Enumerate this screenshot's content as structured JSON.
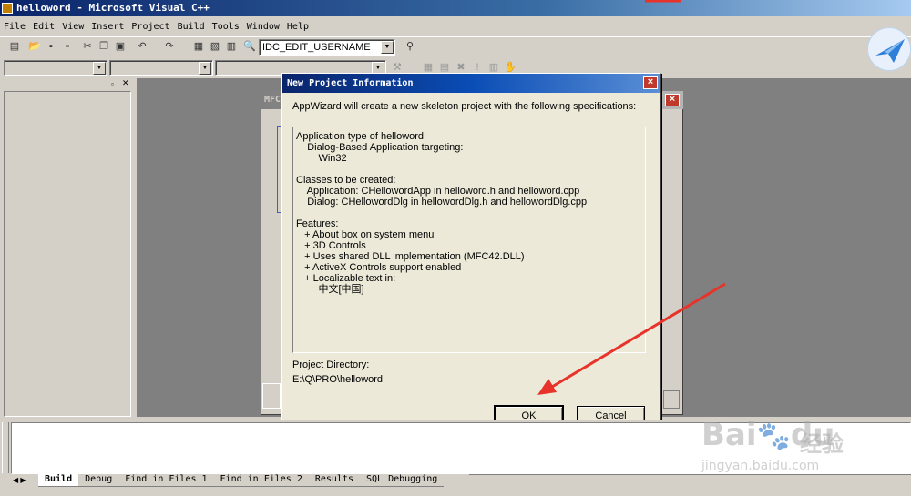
{
  "window": {
    "title": "helloword - Microsoft Visual C++"
  },
  "menu": [
    "File",
    "Edit",
    "View",
    "Insert",
    "Project",
    "Build",
    "Tools",
    "Window",
    "Help"
  ],
  "toolbar": {
    "id_combo_value": "IDC_EDIT_USERNAME"
  },
  "background_window": {
    "title": "MFC"
  },
  "dialog": {
    "title": "New Project Information",
    "intro": "AppWizard will create a new skeleton project with the following specifications:",
    "spec_lines": [
      "Application type of helloword:",
      "    Dialog-Based Application targeting:",
      "        Win32",
      "",
      "Classes to be created:",
      "    Application: CHellowordApp in helloword.h and helloword.cpp",
      "    Dialog: CHellowordDlg in hellowordDlg.h and hellowordDlg.cpp",
      "",
      "Features:",
      "   + About box on system menu",
      "   + 3D Controls",
      "   + Uses shared DLL implementation (MFC42.DLL)",
      "   + ActiveX Controls support enabled",
      "   + Localizable text in:",
      "        中文[中国]"
    ],
    "project_dir_label": "Project Directory:",
    "project_dir_value": "E:\\Q\\PRO\\helloword",
    "ok_label": "OK",
    "cancel_label": "Cancel"
  },
  "output_tabs": [
    "Build",
    "Debug",
    "Find in Files 1",
    "Find in Files 2",
    "Results",
    "SQL Debugging"
  ],
  "watermark": {
    "brand": "Bai",
    "brand2": "du",
    "cn": "经验",
    "url": "jingyan.baidu.com"
  },
  "colors": {
    "arrow": "#e8332a",
    "title_active": "#0a246a",
    "accent": "#2f7fd8"
  }
}
